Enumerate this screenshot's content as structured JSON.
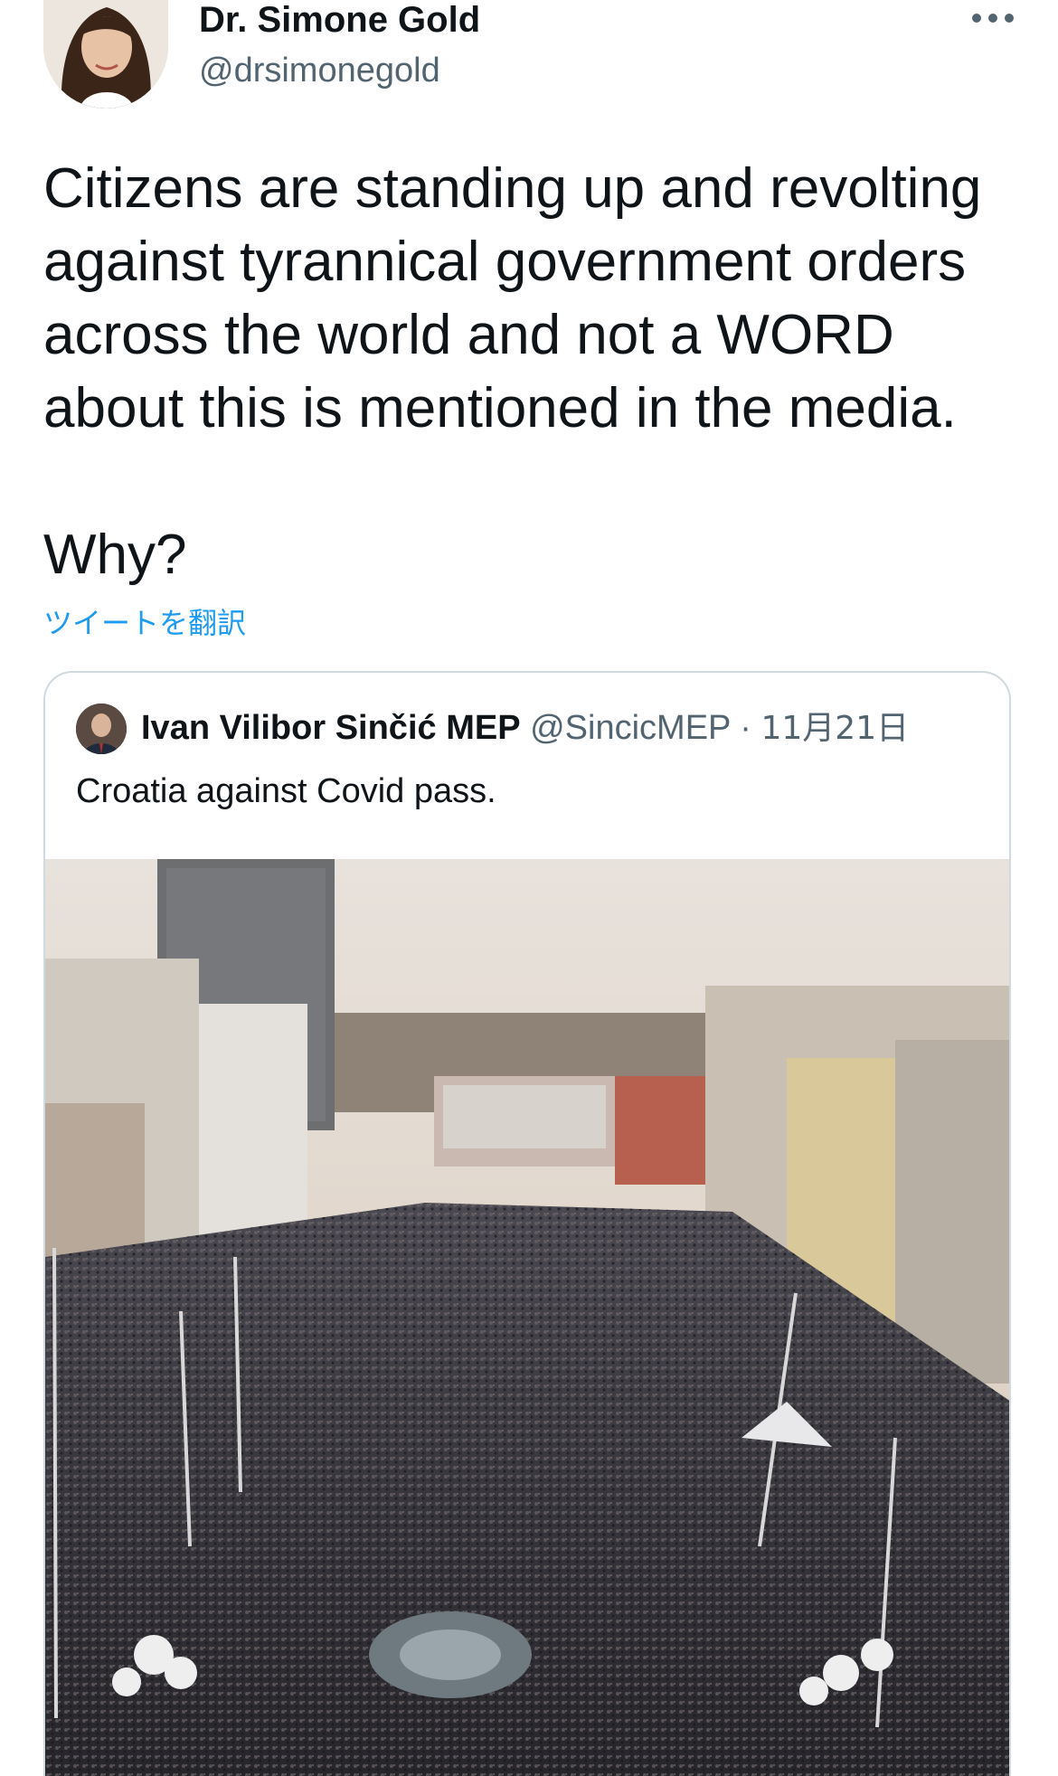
{
  "author": {
    "name": "Dr. Simone Gold",
    "handle": "@drsimonegold"
  },
  "tweet": {
    "text": "Citizens are standing up and revolting\nagainst tyrannical government orders\nacross the world and not a WORD\nabout this is mentioned in the media.\n\nWhy?",
    "translate_label": "ツイートを翻訳"
  },
  "quoted": {
    "name": "Ivan Vilibor Sinčić MEP",
    "handle": "@SincicMEP",
    "separator": "·",
    "date": "11月21日",
    "text": "Croatia against Covid pass."
  },
  "icons": {
    "more": "more-horizontal-icon"
  },
  "colors": {
    "text_primary": "#0f1419",
    "text_secondary": "#536471",
    "link": "#1d9bf0",
    "border": "#cfd9de"
  }
}
